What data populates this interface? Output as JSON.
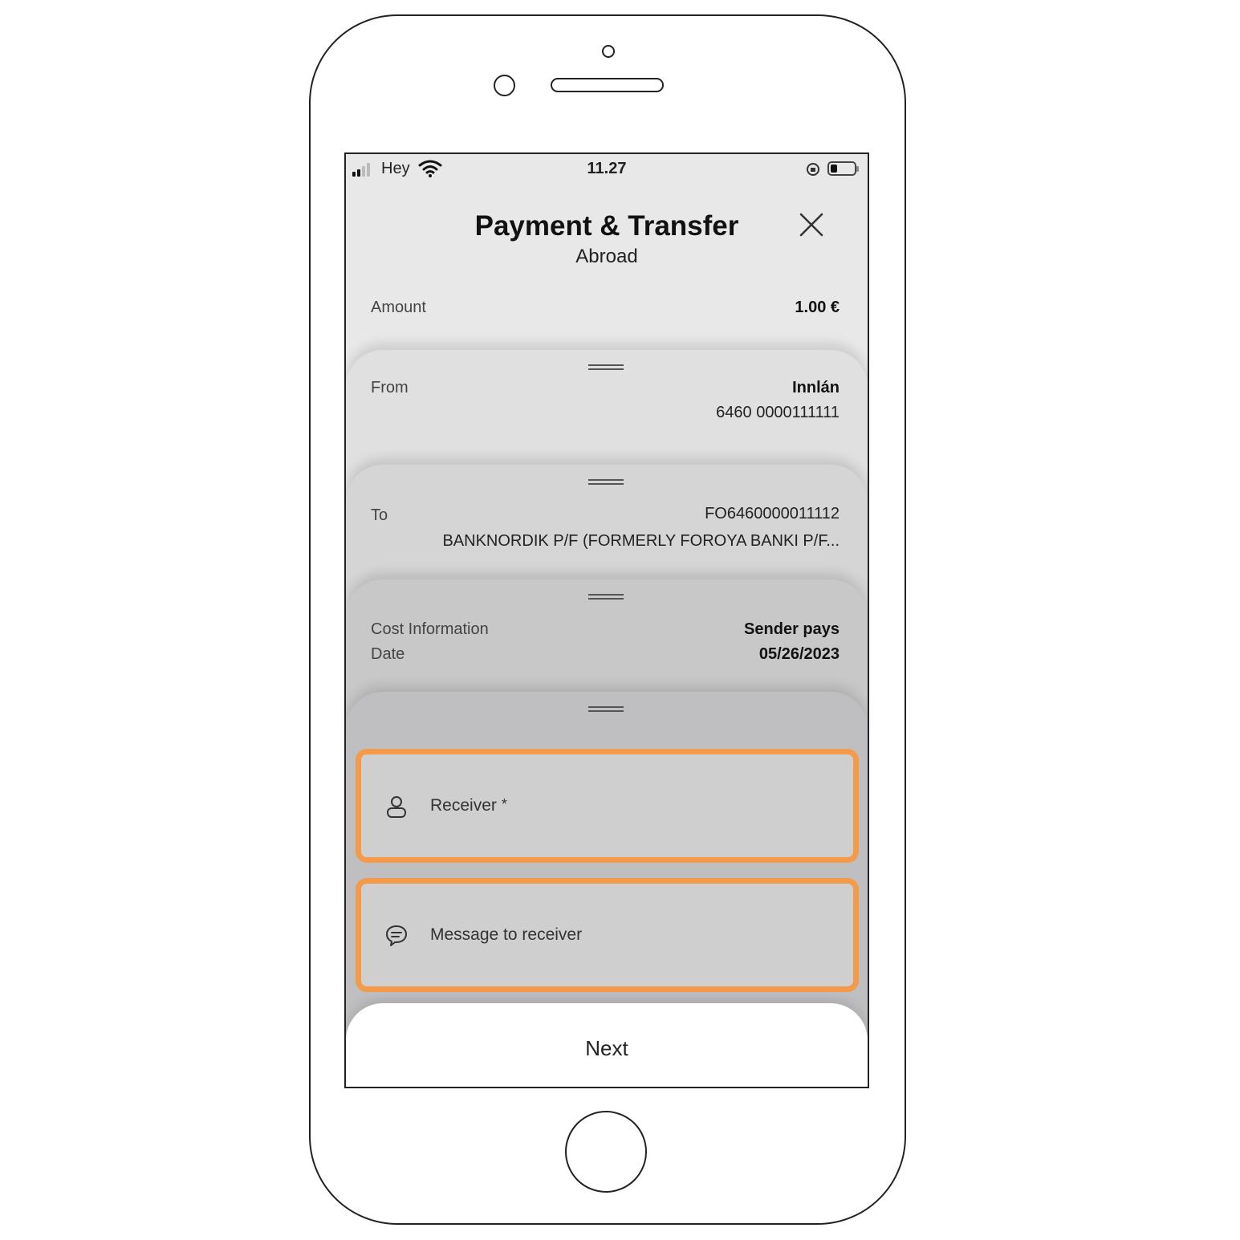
{
  "status_bar": {
    "carrier": "Hey",
    "time": "11.27"
  },
  "header": {
    "title": "Payment & Transfer",
    "subtitle": "Abroad"
  },
  "amount": {
    "label": "Amount",
    "value": "1.00 €"
  },
  "from": {
    "label": "From",
    "account_name": "Innlán",
    "account_number": "6460 0000111111"
  },
  "to": {
    "label": "To",
    "iban": "FO6460000011112",
    "bank": "BANKNORDIK P/F (FORMERLY FOROYA BANKI P/F..."
  },
  "cost": {
    "cost_label": "Cost Information",
    "cost_value": "Sender pays",
    "date_label": "Date",
    "date_value": "05/26/2023"
  },
  "fields": {
    "receiver_label": "Receiver",
    "receiver_required": "*",
    "message_label": "Message to receiver"
  },
  "footer": {
    "next_label": "Next"
  },
  "colors": {
    "highlight": "#f39a4b",
    "screen_bg": "#e8e8e8"
  },
  "icons": [
    "signal-icon",
    "wifi-icon",
    "rotation-lock-icon",
    "battery-icon",
    "close-icon",
    "person-icon",
    "message-icon"
  ]
}
